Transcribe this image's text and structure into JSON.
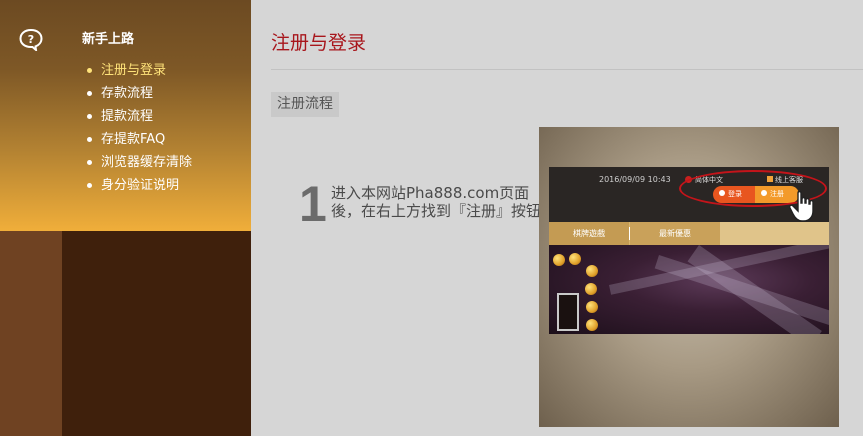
{
  "sidebar": {
    "title": "新手上路",
    "items": [
      {
        "label": "注册与登录",
        "active": true
      },
      {
        "label": "存款流程",
        "active": false
      },
      {
        "label": "提款流程",
        "active": false
      },
      {
        "label": "存提款FAQ",
        "active": false
      },
      {
        "label": "浏览器缓存清除",
        "active": false
      },
      {
        "label": "身分验证说明",
        "active": false
      }
    ]
  },
  "main": {
    "title": "注册与登录",
    "section_label": "注册流程",
    "step": {
      "number": "1",
      "text": "进入本网站Pha888.com页面後，在右上方找到『注册』按钮"
    }
  },
  "illustration": {
    "datetime": "2016/09/09 10:43",
    "language": "简体中文",
    "service": "线上客服",
    "login_label": "登录",
    "register_label": "注册",
    "tab1": "棋牌遊戲",
    "tab2": "最新優惠"
  },
  "colors": {
    "accent_red": "#a8161c",
    "sidebar_gold": "#f0ae3a",
    "active_item": "#ffe37a"
  }
}
